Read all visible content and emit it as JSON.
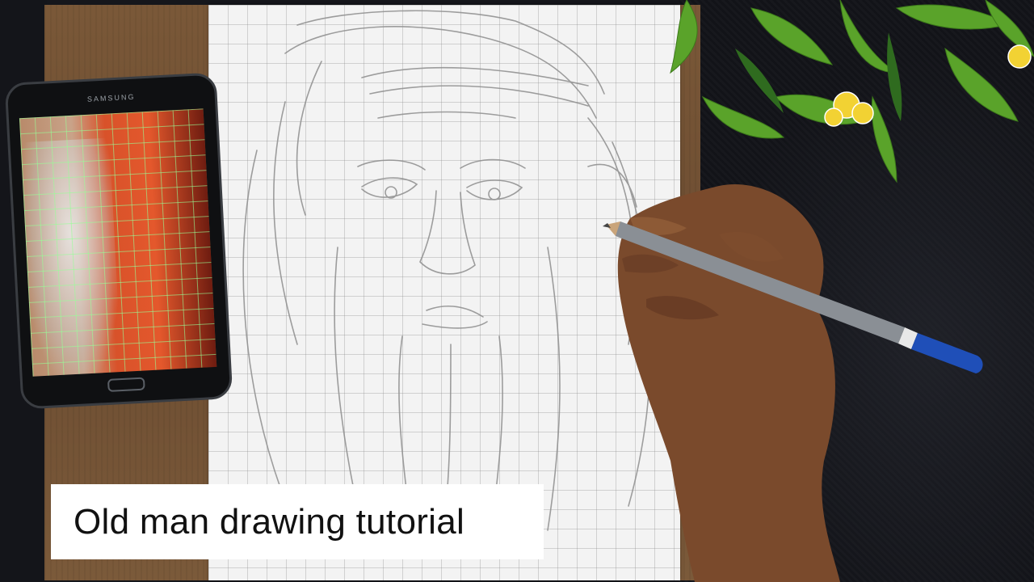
{
  "caption": {
    "title": "Old man drawing tutorial"
  },
  "phone": {
    "brand": "SAMSUNG"
  },
  "colors": {
    "paper": "#f3f3f3",
    "board": "#6c4c31",
    "cloth": "#15161b",
    "pencil_body": "#8a8f95",
    "pencil_cap": "#1f4fb8"
  }
}
